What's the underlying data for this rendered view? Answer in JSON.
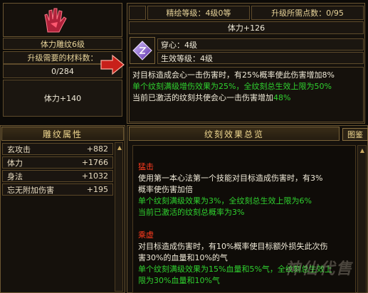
{
  "item": {
    "name": "体力雕纹6级",
    "material_label": "升级需要的材料数：",
    "material_count": "0/284",
    "bonus": "体力+140"
  },
  "upgrade": {
    "refine_level": "精绘等级：4级0等",
    "points_needed": "升级所需点数：0/95",
    "stat": "体力+126"
  },
  "engrave": {
    "name": "穿心：4级",
    "effect_level": "生效等级：4级",
    "desc_line1": "对目标造成会心一击伤害时，有25%概率使此伤害增加8%",
    "desc_line2": "单个纹刻满级增伤效果为25%，全纹刻总生效上限为50%",
    "desc_line3_prefix": "当前已激活的纹刻共使会心一击伤害增加",
    "desc_line3_value": "48%"
  },
  "attributes": {
    "header": "雕纹属性",
    "rows": [
      {
        "name": "玄攻击",
        "value": "+882"
      },
      {
        "name": "体力",
        "value": "+1766"
      },
      {
        "name": "身法",
        "value": "+1032"
      },
      {
        "name": "忘无附加伤害",
        "value": "+195"
      }
    ]
  },
  "overview": {
    "header": "纹刻效果总览",
    "tab_label": "图鉴",
    "items": [
      {
        "title": "猛击",
        "lines": [
          "使用第一本心法第一个技能对目标造成伤害时，有3%",
          "概率使伤害加倍"
        ],
        "green_lines": [
          "单个纹刻满级效果为3%，全纹刻总生效上限为6%"
        ],
        "active_line": "当前已激活的纹刻总概率为3%"
      },
      {
        "title": "乘虚",
        "lines": [
          "对目标造成伤害时，有10%概率使目标额外损失此次伤",
          "害30%的血量和10%的气"
        ],
        "green_lines": [
          "单个纹刻满级效果为15%血量和5%气，全纹刻总生效上",
          "限为30%血量和10%气"
        ],
        "active_line": ""
      }
    ]
  },
  "watermark": "神仙代售",
  "colors": {
    "accent": "#e8d49a",
    "green": "#2fd12f",
    "red": "#ff3b1f"
  }
}
